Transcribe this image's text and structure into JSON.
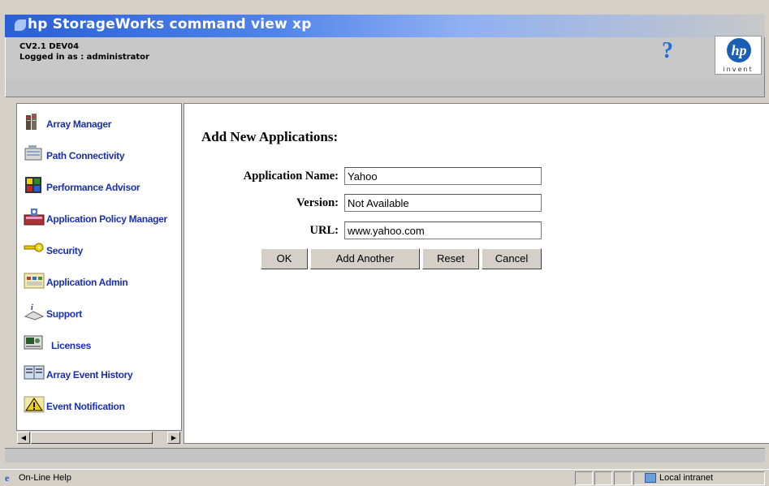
{
  "app": {
    "title": "hp StorageWorks command view xp",
    "version_line": "CV2.1 DEV04",
    "login_line": "Logged in as : administrator"
  },
  "nav": {
    "items": [
      {
        "label": "Array Manager",
        "icon": "array-manager-icon"
      },
      {
        "label": "Path Connectivity",
        "icon": "path-connectivity-icon"
      },
      {
        "label": "Performance Advisor",
        "icon": "performance-advisor-icon"
      },
      {
        "label": "Application Policy Manager",
        "icon": "application-policy-icon"
      },
      {
        "label": "Security",
        "icon": "key-icon"
      },
      {
        "label": "Application Admin",
        "icon": "application-admin-icon"
      },
      {
        "label": "Support",
        "icon": "support-icon"
      },
      {
        "label": "Licenses",
        "icon": "licenses-icon"
      },
      {
        "label": "Array Event History",
        "icon": "event-history-icon"
      },
      {
        "label": "Event Notification",
        "icon": "warning-icon"
      }
    ]
  },
  "form": {
    "title": "Add New Applications:",
    "fields": {
      "name": {
        "label": "Application Name:",
        "value": "Yahoo"
      },
      "version": {
        "label": "Version:",
        "value": "Not Available"
      },
      "url": {
        "label": "URL:",
        "value": "www.yahoo.com"
      }
    },
    "buttons": {
      "ok": "OK",
      "add_another": "Add Another",
      "reset": "Reset",
      "cancel": "Cancel"
    }
  },
  "status": {
    "help_text": "On-Line Help",
    "zone": "Local intranet"
  },
  "logo": {
    "brand": "hp",
    "tagline": "invent"
  },
  "colors": {
    "nav_link": "#1a2fb0",
    "titlebar": "#2a5fd6"
  }
}
